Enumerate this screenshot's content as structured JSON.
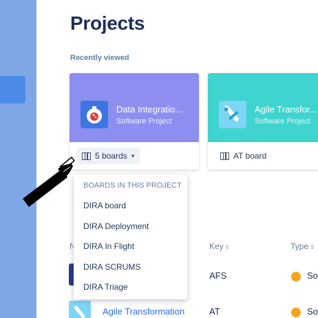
{
  "page": {
    "title": "Projects",
    "recently_viewed_label": "Recently viewed"
  },
  "cards": [
    {
      "name": "Data Integratio...",
      "type": "Software Project",
      "boards_label": "5 boards",
      "accent": "#8c8ff0"
    },
    {
      "name": "Agile Transfor...",
      "type": "Software Project",
      "boards_label": "AT board",
      "accent": "#3fd4cf"
    }
  ],
  "dropdown": {
    "heading": "BOARDS IN THIS PROJECT",
    "items": [
      "DIRA board",
      "DIRA Deployment",
      "DIRA In Flight",
      "DIRA SCRUMS",
      "DIRA Triage"
    ]
  },
  "table": {
    "headers": {
      "name": "N",
      "key": "Key",
      "type": "Type"
    },
    "rows": [
      {
        "name": "",
        "key": "AFS",
        "type": "So"
      },
      {
        "name": "Agile Transformation",
        "key": "AT",
        "type": "So"
      }
    ]
  },
  "colors": {
    "sidebar": "#7fa7e6",
    "link": "#2d6de0",
    "type_badge": "#f2a516"
  },
  "icons": {
    "pointer": "hand-pointer-icon",
    "board": "board-icon",
    "chevron": "chevron-down-icon"
  }
}
